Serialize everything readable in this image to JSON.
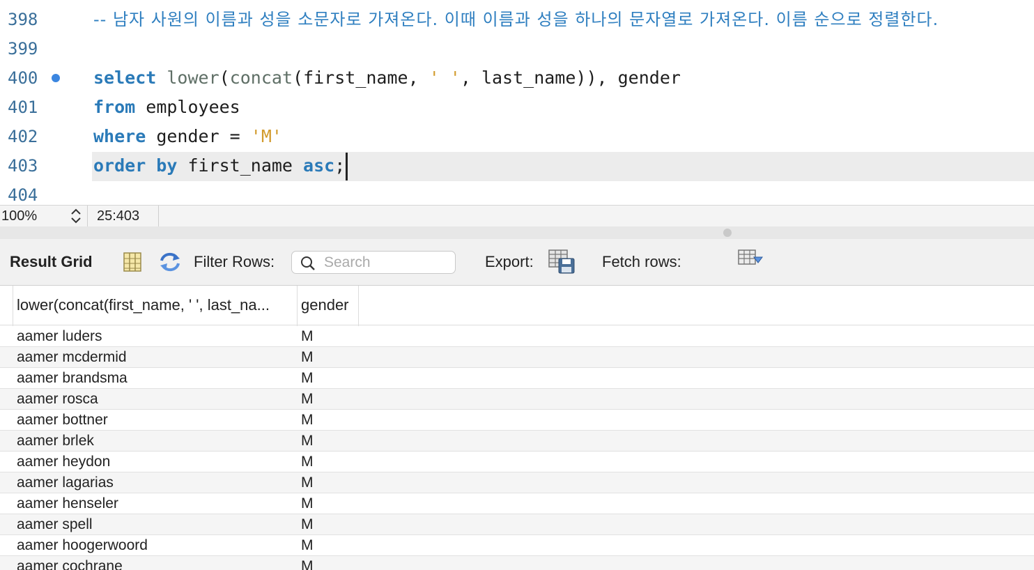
{
  "editor": {
    "lines": [
      {
        "num": "398",
        "text": "-- 남자 사원의 이름과 성을 소문자로 가져온다. 이때 이름과 성을 하나의 문자열로 가져온다. 이름 순으로 정렬한다."
      },
      {
        "num": "399"
      },
      {
        "num": "400",
        "tokens": [
          "select",
          "lower",
          "(",
          "concat",
          "(first_name, ",
          "' '",
          ", last_name)), gender"
        ]
      },
      {
        "num": "401",
        "tokens": [
          "from",
          " employees"
        ]
      },
      {
        "num": "402",
        "tokens": [
          "where",
          " gender = ",
          "'M'"
        ]
      },
      {
        "num": "403",
        "tokens": [
          "order by",
          " first_name ",
          "asc",
          ";"
        ]
      },
      {
        "num": "404"
      }
    ]
  },
  "status": {
    "zoom": "100%",
    "cursor": "25:403"
  },
  "toolbar": {
    "result_grid": "Result Grid",
    "filter_rows": "Filter Rows:",
    "search_placeholder": "Search",
    "export": "Export:",
    "fetch_rows": "Fetch rows:"
  },
  "grid": {
    "columns": [
      "lower(concat(first_name, ' ', last_na...",
      "gender"
    ],
    "rows": [
      [
        "aamer luders",
        "M"
      ],
      [
        "aamer mcdermid",
        "M"
      ],
      [
        "aamer brandsma",
        "M"
      ],
      [
        "aamer rosca",
        "M"
      ],
      [
        "aamer bottner",
        "M"
      ],
      [
        "aamer brlek",
        "M"
      ],
      [
        "aamer heydon",
        "M"
      ],
      [
        "aamer lagarias",
        "M"
      ],
      [
        "aamer henseler",
        "M"
      ],
      [
        "aamer spell",
        "M"
      ],
      [
        "aamer hoogerwoord",
        "M"
      ],
      [
        "aamer cochrane",
        "M"
      ]
    ]
  },
  "colors": {
    "keyword": "#2a7ab8",
    "string": "#d29b2d",
    "comment": "#2f7fc0",
    "line_number": "#3a6f9a"
  }
}
